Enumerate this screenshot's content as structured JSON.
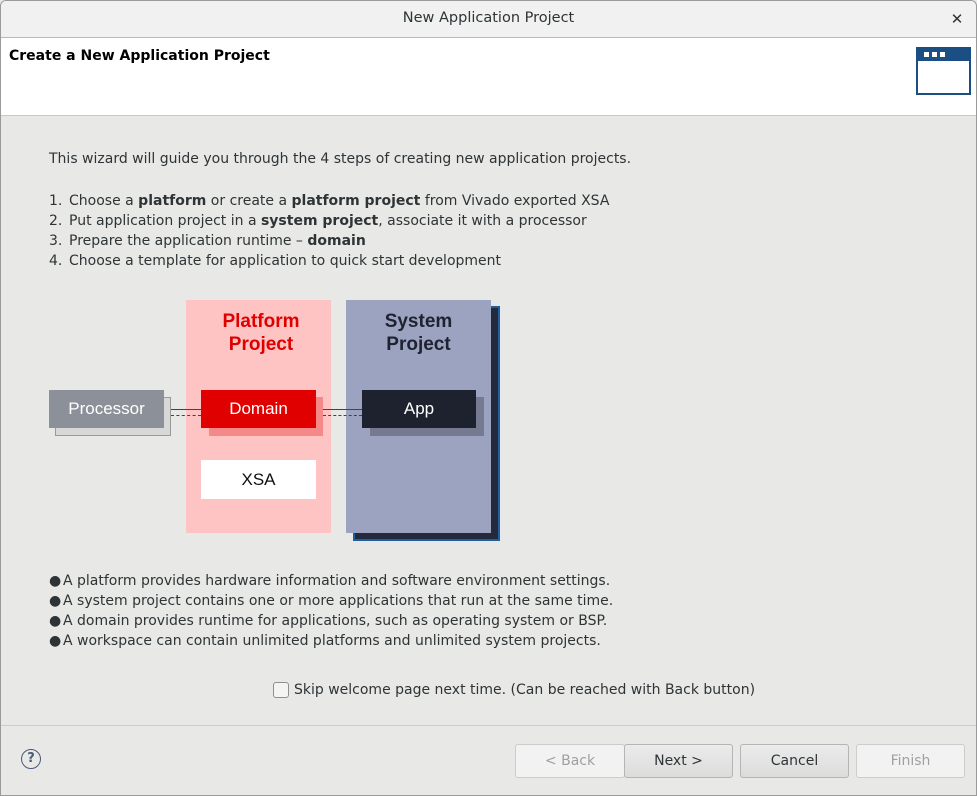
{
  "window": {
    "title": "New Application Project",
    "close_glyph": "✕"
  },
  "banner": {
    "heading": "Create a New Application Project",
    "icon": "wizard-window-icon"
  },
  "intro": "This wizard will guide you through the 4 steps of creating new application projects.",
  "steps": [
    {
      "num": "1.",
      "parts": [
        [
          "Choose a ",
          false
        ],
        [
          "platform",
          true
        ],
        [
          " or create a ",
          false
        ],
        [
          "platform project",
          true
        ],
        [
          " from Vivado exported XSA",
          false
        ]
      ]
    },
    {
      "num": "2.",
      "parts": [
        [
          "Put application project in a ",
          false
        ],
        [
          "system project",
          true
        ],
        [
          ", associate it with a processor",
          false
        ]
      ]
    },
    {
      "num": "3.",
      "parts": [
        [
          "Prepare the application runtime – ",
          false
        ],
        [
          "domain",
          true
        ]
      ]
    },
    {
      "num": "4.",
      "parts": [
        [
          "Choose a template for application to quick start development",
          false
        ]
      ]
    }
  ],
  "diagram": {
    "platform_title_line1": "Platform",
    "platform_title_line2": "Project",
    "system_title_line1": "System",
    "system_title_line2": "Project",
    "processor": "Processor",
    "domain": "Domain",
    "xsa": "XSA",
    "app": "App",
    "colors": {
      "platform_bg": "#fec3c3",
      "platform_accent": "#e00000",
      "system_bg": "#9ca3c0",
      "app": "#1e222f",
      "processor": "#8c9098"
    }
  },
  "bullets": [
    "A platform provides hardware information and software environment settings.",
    "A system project contains one or more applications that run at the same time.",
    "A domain provides runtime for applications, such as operating system or BSP.",
    "A workspace can contain unlimited platforms and unlimited system projects."
  ],
  "bullet_glyph": "●",
  "skip_checkbox": {
    "label": "Skip welcome page next time. (Can be reached with Back button)",
    "checked": false
  },
  "footer": {
    "help_glyph": "?",
    "back": "< Back",
    "next": "Next >",
    "cancel": "Cancel",
    "finish": "Finish"
  }
}
